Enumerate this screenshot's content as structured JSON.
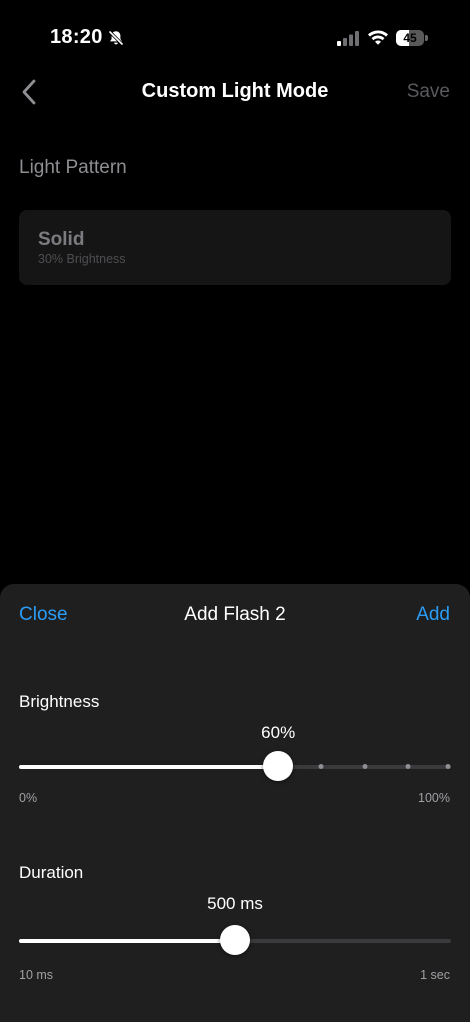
{
  "status_bar": {
    "time": "18:20",
    "battery_level": "45",
    "icons": [
      "bell-slash-icon",
      "cellular-signal-icon",
      "wifi-icon",
      "battery-icon"
    ]
  },
  "nav": {
    "back_icon": "chevron-left-icon",
    "title": "Custom Light Mode",
    "save_label": "Save"
  },
  "light_pattern": {
    "section_label": "Light Pattern",
    "name": "Solid",
    "detail": "30% Brightness"
  },
  "sheet": {
    "close_label": "Close",
    "title": "Add Flash 2",
    "add_label": "Add",
    "brightness": {
      "label": "Brightness",
      "value_text": "60%",
      "value_fraction": 0.6,
      "step_fractions": [
        0.7,
        0.8,
        0.9,
        1.0
      ],
      "min_label": "0%",
      "max_label": "100%"
    },
    "duration": {
      "label": "Duration",
      "value_text": "500 ms",
      "value_fraction": 0.5,
      "min_label": "10 ms",
      "max_label": "1 sec"
    }
  },
  "colors": {
    "accent": "#2a9cf5",
    "sheet_background": "#1f1f1f",
    "card_background": "#151515"
  }
}
